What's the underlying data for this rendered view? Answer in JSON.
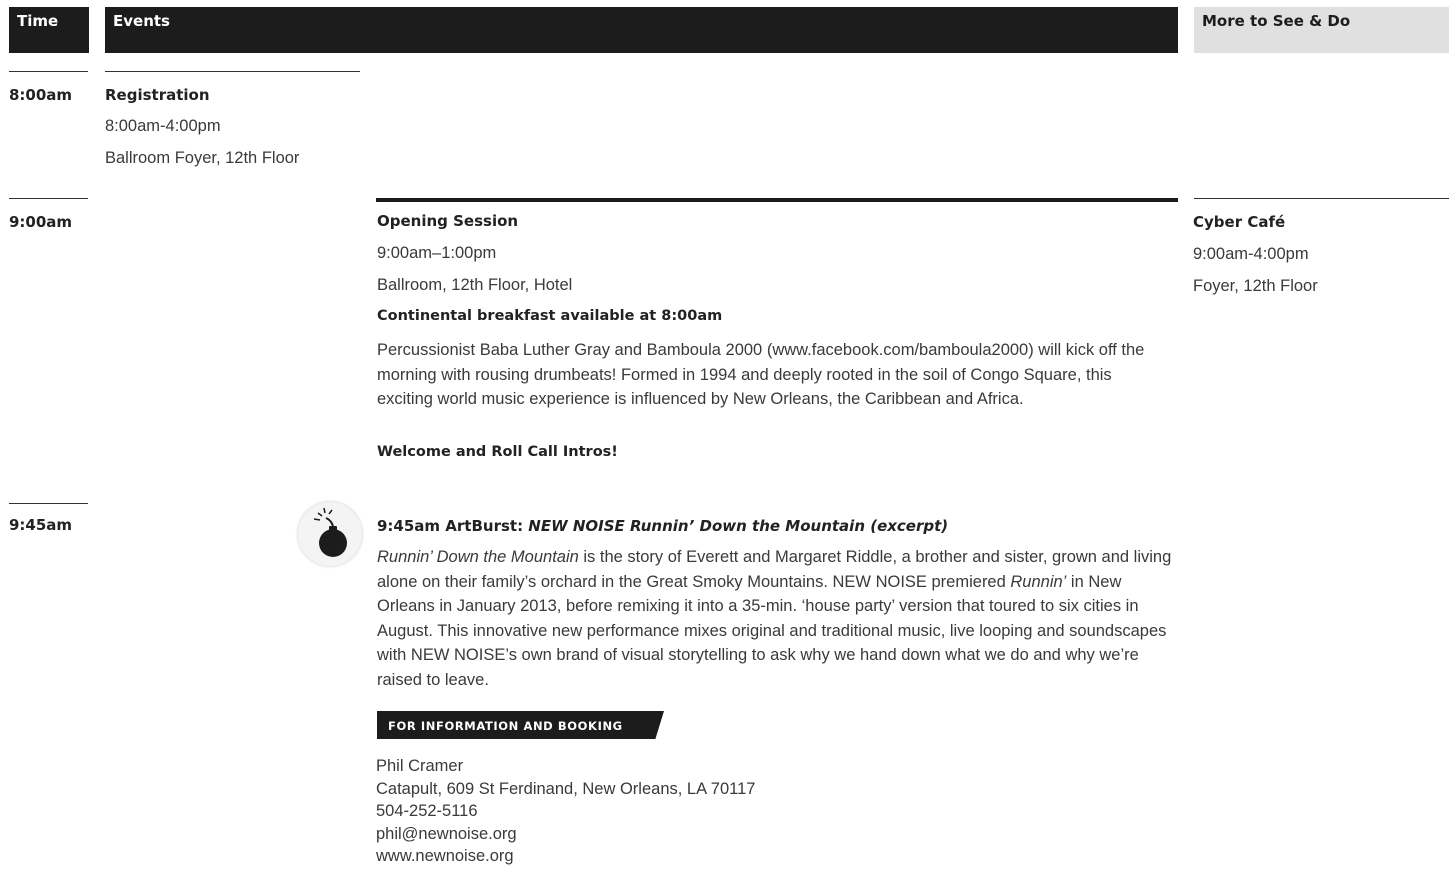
{
  "header": {
    "time_label": "Time",
    "events_label": "Events",
    "more_label": "More to See & Do"
  },
  "slots": [
    {
      "time": "8:00am",
      "event": {
        "title": "Registration",
        "hours": "8:00am-4:00pm",
        "location": "Ballroom Foyer, 12th Floor"
      }
    },
    {
      "time": "9:00am",
      "event": {
        "title": "Opening Session",
        "hours": "9:00am–1:00pm",
        "location": "Ballroom, 12th Floor, Hotel",
        "breakfast": "Continental breakfast available at 8:00am",
        "description": "Percussionist Baba Luther Gray and Bamboula 2000 (www.facebook.com/bamboula2000) will kick off the morning with rousing drumbeats! Formed in 1994 and deeply rooted in the soil of Congo Square, this exciting world music experience is influenced by New Orleans, the Caribbean and Africa.",
        "welcome": "Welcome and Roll Call Intros!"
      },
      "more": {
        "title": "Cyber Café",
        "hours": "9:00am-4:00pm",
        "location": "Foyer, 12th Floor"
      }
    },
    {
      "time": "9:45am",
      "event": {
        "title_prefix": "9:45am ArtBurst: ",
        "title_italic": "NEW NOISE Runnin’ Down the Mountain (excerpt)",
        "desc_em1": "Runnin’ Down the Mountain",
        "desc_t1": " is the story of Everett and Margaret Riddle, a brother and sister, grown and living alone on their family’s orchard in the Great Smoky Mountains. NEW NOISE premiered ",
        "desc_em2": "Runnin’",
        "desc_t2": " in New Orleans in January 2013, before remixing it into a 35-min. ‘house party’ version that toured to six cities in August. This innovative new performance mixes original and traditional music, live looping and soundscapes with NEW NOISE’s own brand of visual storytelling to ask why we hand down what we do and why we’re raised to leave.",
        "icon": "bomb-icon",
        "info_tag": "FOR INFORMATION AND BOOKING",
        "contact": {
          "name": "Phil Cramer",
          "address": "Catapult, 609 St Ferdinand, New Orleans, LA 70117",
          "phone": "504-252-5116",
          "email": "phil@newnoise.org",
          "web": "www.newnoise.org"
        }
      }
    }
  ],
  "colors": {
    "header_dark": "#1c1c1c",
    "header_light": "#e0e0e0",
    "text": "#3a3a3a"
  }
}
